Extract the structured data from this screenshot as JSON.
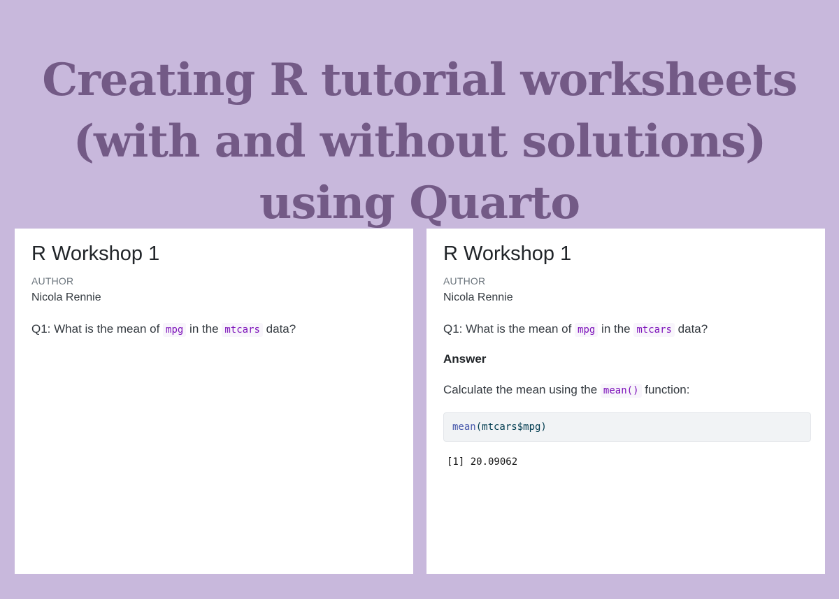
{
  "headline": {
    "line1": "Creating R tutorial worksheets",
    "line2": "(with and without solutions)",
    "line3": "using Quarto"
  },
  "left_panel": {
    "title": "R Workshop 1",
    "author_label": "AUTHOR",
    "author_name": "Nicola Rennie",
    "question": {
      "prefix": "Q1: What is the mean of ",
      "code1": "mpg",
      "middle": " in the ",
      "code2": "mtcars",
      "suffix": " data?"
    }
  },
  "right_panel": {
    "title": "R Workshop 1",
    "author_label": "AUTHOR",
    "author_name": "Nicola Rennie",
    "question": {
      "prefix": "Q1: What is the mean of ",
      "code1": "mpg",
      "middle": " in the ",
      "code2": "mtcars",
      "suffix": " data?"
    },
    "answer_heading": "Answer",
    "answer_text": {
      "prefix": "Calculate the mean using the ",
      "code": "mean()",
      "suffix": " function:"
    },
    "code_block": {
      "fn": "mean",
      "args": "(mtcars$mpg)"
    },
    "output": "[1] 20.09062"
  },
  "colors": {
    "background": "#c8b8dc",
    "headline": "#735a86",
    "inline_code": "#7d12ba"
  }
}
